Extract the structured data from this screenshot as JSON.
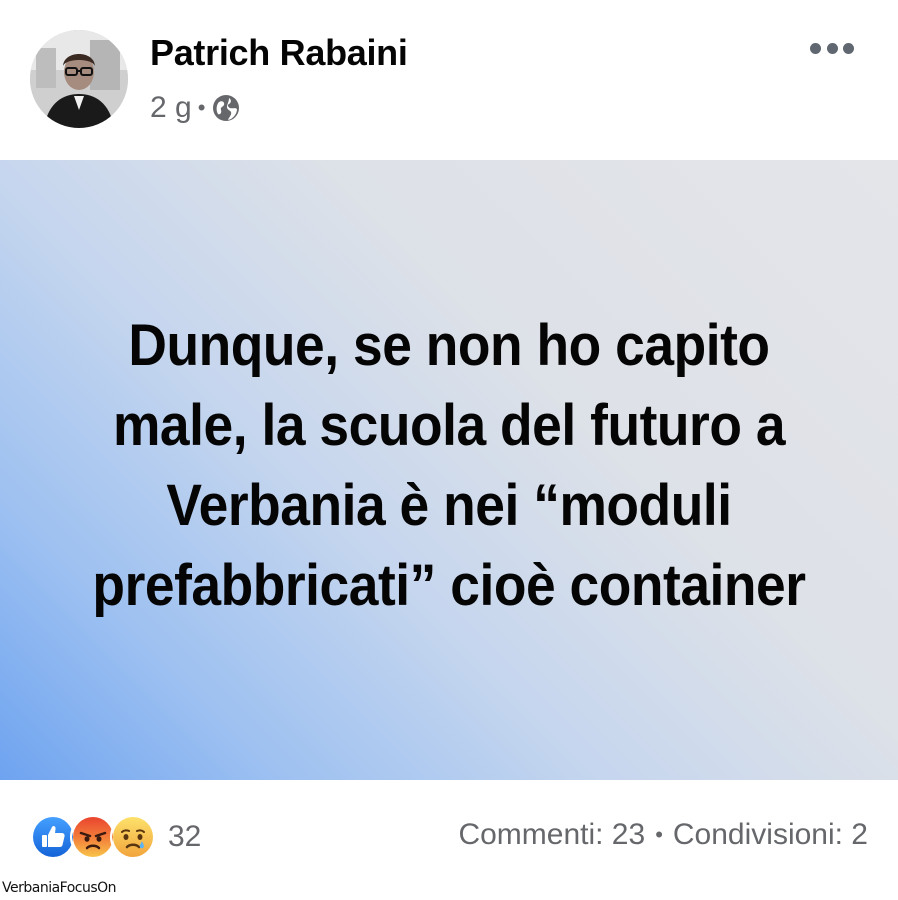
{
  "post": {
    "author": {
      "name": "Patrich Rabaini",
      "avatar_icon": "profile-photo"
    },
    "timestamp": "2 g",
    "separator": "•",
    "audience_icon": "globe-icon",
    "more_icon": "more-options-icon",
    "text": "Dunque, se non ho capito male, la scuola del futuro a Verbania è nei “moduli prefabbricati” cioè container",
    "background": {
      "gradient_from": "#6ea3f0",
      "gradient_to": "#e4e5e9"
    },
    "reactions": {
      "types": [
        "like",
        "angry",
        "sad"
      ],
      "count": "32",
      "colors": {
        "like": "#1877f2",
        "angry": "#f0533a",
        "sad": "#f7c04a"
      }
    },
    "stats": {
      "comments": "Commenti: 23",
      "separator": "•",
      "shares": "Condivisioni: 2"
    }
  },
  "watermark": "VerbaniaFocusOn"
}
